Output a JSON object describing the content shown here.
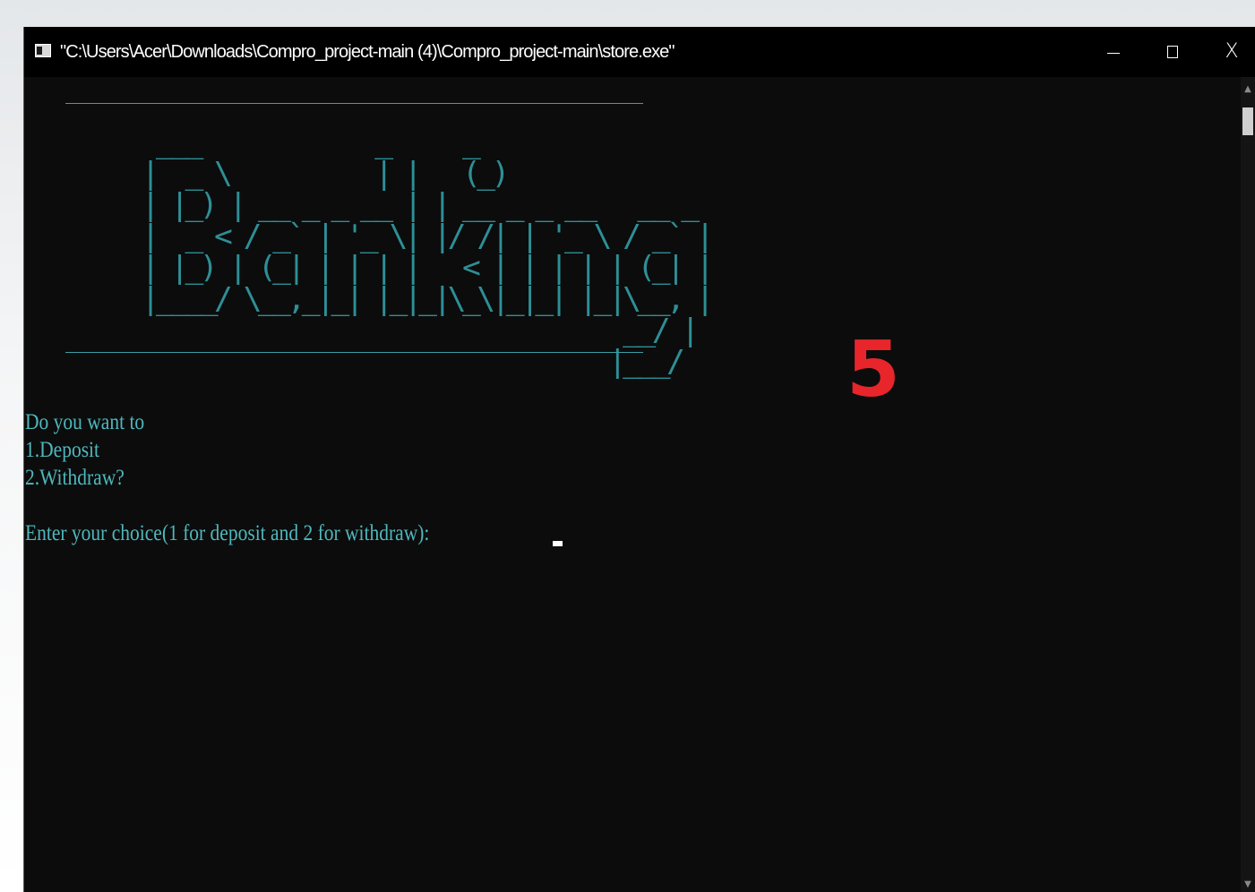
{
  "window": {
    "title": "\"C:\\Users\\Acer\\Downloads\\Compro_project-main (4)\\Compro_project-main\\store.exe\"",
    "controls": {
      "minimize_icon": "minimize-icon",
      "maximize_icon": "maximize-icon",
      "close_icon": "close-icon",
      "close_glyph": "X"
    }
  },
  "console": {
    "banner_art": "   ___            _     _\n  |  _ \\          | |   (_)\n  | |_) | __ _ _ __ | | __ _ _ __   __ _\n  |  _ < / _` | '_ \\| |/ /| | '_ \\ / _` |\n  | |_) | (_| | | | |   < | | | | | (_| |\n  |____/ \\__,_|_| |_|_|\\_\\|_|_| |_|\\__, |\n                                   __/ |\n                                  |___/",
    "banner_word": "Banking",
    "lines": [
      "Do you want to",
      "1.Deposit",
      "2.Withdraw?",
      "Enter your choice(1 for deposit and 2 for withdraw):"
    ],
    "text_color": "#4fb8bd",
    "background_color": "#0c0c0c"
  },
  "overlay": {
    "number": "5",
    "color": "#e8252b"
  }
}
